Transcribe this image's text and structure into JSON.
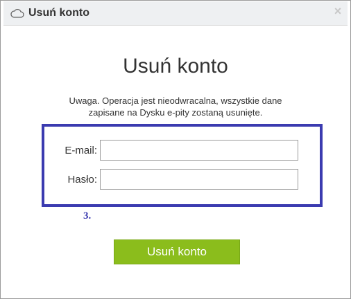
{
  "dialog": {
    "title": "Usuń konto",
    "close_glyph": "×",
    "title_icon": "cloud-icon"
  },
  "main": {
    "heading": "Usuń konto",
    "warning_line1": "Uwaga. Operacja jest nieodwracalna, wszystkie dane",
    "warning_line2": "zapisane na Dysku e-pity zostaną usunięte."
  },
  "form": {
    "email_label": "E-mail:",
    "email_value": "",
    "password_label": "Hasło:",
    "password_value": "",
    "step_annotation": "3."
  },
  "actions": {
    "submit_label": "Usuń konto"
  },
  "colors": {
    "accent_button": "#8bbd1c",
    "annotation_border": "#3b3bb0"
  }
}
